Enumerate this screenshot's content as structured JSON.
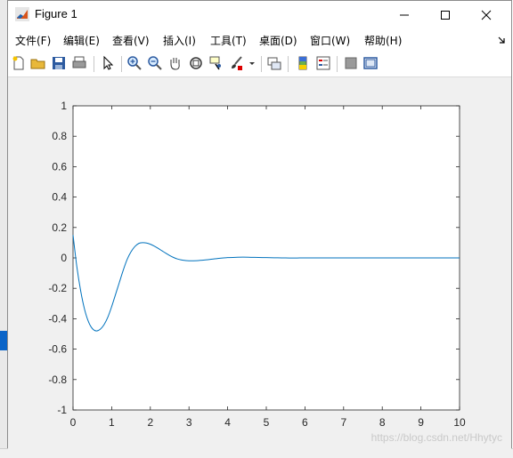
{
  "window": {
    "title": "Figure 1"
  },
  "menu": {
    "items": [
      {
        "label": "文件(F)",
        "name": "menu-file"
      },
      {
        "label": "编辑(E)",
        "name": "menu-edit"
      },
      {
        "label": "查看(V)",
        "name": "menu-view"
      },
      {
        "label": "插入(I)",
        "name": "menu-insert"
      },
      {
        "label": "工具(T)",
        "name": "menu-tools"
      },
      {
        "label": "桌面(D)",
        "name": "menu-desktop"
      },
      {
        "label": "窗口(W)",
        "name": "menu-window"
      },
      {
        "label": "帮助(H)",
        "name": "menu-help"
      }
    ]
  },
  "toolbar": {
    "icons": [
      "new-figure-icon",
      "open-file-icon",
      "save-icon",
      "print-icon",
      "pointer-icon",
      "zoom-in-icon",
      "zoom-out-icon",
      "pan-icon",
      "rotate-3d-icon",
      "data-cursor-icon",
      "brush-icon",
      "brush-dropdown-icon",
      "link-plot-icon",
      "colorbar-icon",
      "legend-icon",
      "hide-plot-tools-icon",
      "show-plot-tools-icon"
    ]
  },
  "watermark": "https://blog.csdn.net/Hhytyc",
  "colors": {
    "line": "#0072bd",
    "axes_bg": "#ffffff",
    "figure_bg": "#f0f0f0"
  },
  "chart_data": {
    "type": "line",
    "title": "",
    "xlabel": "",
    "ylabel": "",
    "xlim": [
      0,
      10
    ],
    "ylim": [
      -1,
      1
    ],
    "xticks": [
      0,
      1,
      2,
      3,
      4,
      5,
      6,
      7,
      8,
      9,
      10
    ],
    "yticks": [
      -1,
      -0.8,
      -0.6,
      -0.4,
      -0.2,
      0,
      0.2,
      0.4,
      0.6,
      0.8,
      1
    ],
    "ytick_labels": [
      "-1",
      "-0.8",
      "-0.6",
      "-0.4",
      "-0.2",
      "0",
      "0.2",
      "0.4",
      "0.6",
      "0.8",
      "1"
    ],
    "xtick_labels": [
      "0",
      "1",
      "2",
      "3",
      "4",
      "5",
      "6",
      "7",
      "8",
      "9",
      "10"
    ],
    "grid": false,
    "series": [
      {
        "x": [
          0,
          0.1,
          0.2,
          0.3,
          0.4,
          0.5,
          0.6,
          0.7,
          0.8,
          0.9,
          1.0,
          1.1,
          1.2,
          1.3,
          1.4,
          1.5,
          1.6,
          1.7,
          1.8,
          1.9,
          2.0,
          2.1,
          2.2,
          2.3,
          2.4,
          2.5,
          2.6,
          2.7,
          2.8,
          2.9,
          3.0,
          3.2,
          3.4,
          3.6,
          3.8,
          4.0,
          4.2,
          4.4,
          4.6,
          4.8,
          5.0,
          5.2,
          5.4,
          5.6,
          5.8,
          6.0,
          6.5,
          7.0,
          7.5,
          8.0,
          8.5,
          9.0,
          9.5,
          10.0
        ],
        "y": [
          0.15,
          -0.06,
          -0.22,
          -0.34,
          -0.42,
          -0.465,
          -0.48,
          -0.47,
          -0.44,
          -0.39,
          -0.32,
          -0.24,
          -0.16,
          -0.08,
          -0.01,
          0.04,
          0.075,
          0.095,
          0.1,
          0.098,
          0.09,
          0.078,
          0.063,
          0.047,
          0.031,
          0.016,
          0.003,
          -0.007,
          -0.013,
          -0.017,
          -0.019,
          -0.018,
          -0.014,
          -0.008,
          -0.002,
          0.002,
          0.004,
          0.005,
          0.004,
          0.003,
          0.002,
          0.001,
          0.0,
          -0.0005,
          -0.0005,
          0,
          0,
          0,
          0,
          0,
          0,
          0,
          0,
          0
        ]
      }
    ]
  }
}
